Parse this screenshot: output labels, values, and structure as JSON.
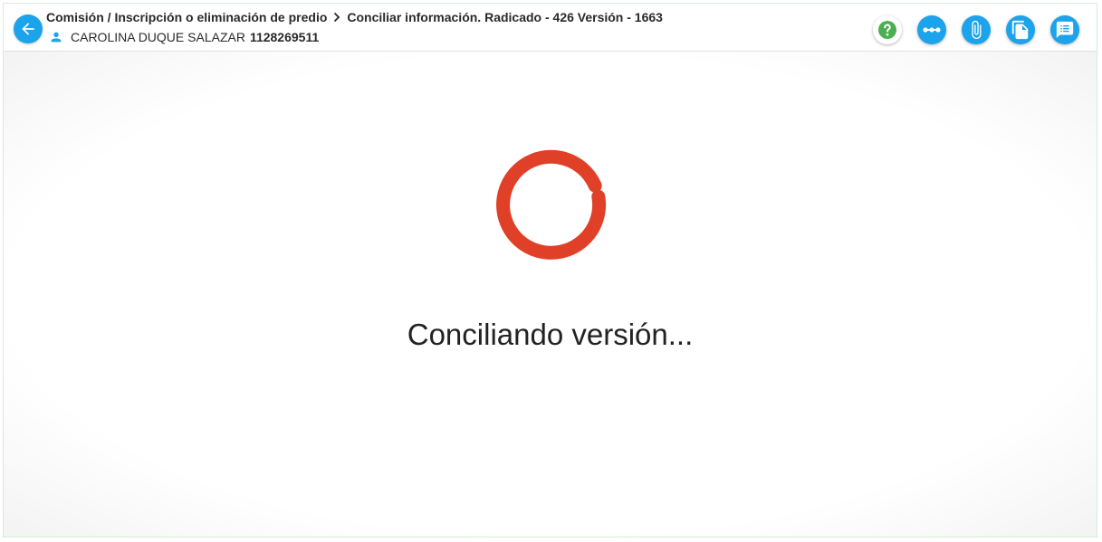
{
  "header": {
    "breadcrumb_first": "Comisión / Inscripción o eliminación de predio",
    "breadcrumb_second": "Conciliar información. Radicado - 426 Versión - 1663",
    "user_name": "CAROLINA DUQUE SALAZAR",
    "user_id": "1128269511"
  },
  "toolbar": {
    "buttons": [
      "help-icon",
      "flow-icon",
      "attachment-icon",
      "documents-icon",
      "comments-icon"
    ]
  },
  "main": {
    "loading_text": "Conciliando versión..."
  },
  "colors": {
    "accent": "#1ba3ec",
    "spinner": "#e04028",
    "help": "#4caf50"
  }
}
